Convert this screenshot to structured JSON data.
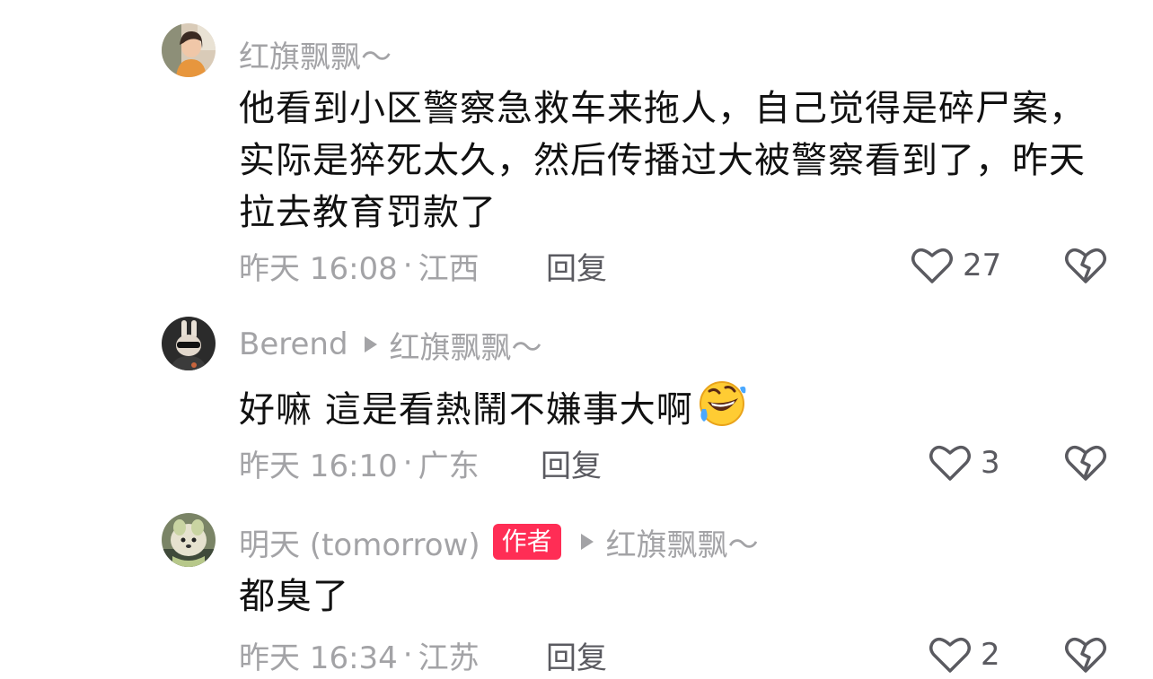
{
  "comments": [
    {
      "username": "红旗飘飘～",
      "text": "他看到小区警察急救车来拖人，自己觉得是碎尸案，实际是猝死太久，然后传播过大被警察看到了，昨天拉去教育罚款了",
      "time": "昨天 16:08",
      "location": "江西",
      "reply_label": "回复",
      "likes": "27"
    },
    {
      "username": "Berend",
      "reply_to": "红旗飘飘～",
      "text": "好嘛 這是看熱鬧不嫌事大啊",
      "emoji": "rolling-laughing-emoji",
      "time": "昨天 16:10",
      "location": "广东",
      "reply_label": "回复",
      "likes": "3"
    },
    {
      "username": "明天 (tomorrow)",
      "badge": "作者",
      "reply_to": "红旗飘飘～",
      "text": "都臭了",
      "time": "昨天 16:34",
      "location": "江苏",
      "reply_label": "回复",
      "likes": "2"
    }
  ],
  "icons": {
    "like": "heart-outline-icon",
    "dislike": "broken-heart-icon"
  },
  "colors": {
    "badge": "#ff2d55",
    "meta_text": "#a3a3a6",
    "body_text": "#111111"
  }
}
